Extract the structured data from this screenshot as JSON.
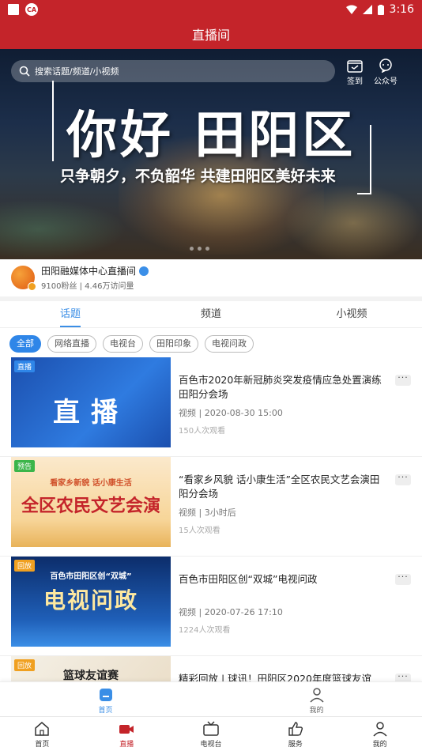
{
  "status_bar": {
    "time": "3:16",
    "app_badge": "CA"
  },
  "header": {
    "title": "直播间"
  },
  "banner": {
    "search_placeholder": "搜索话题/频道/小视频",
    "checkin_label": "签到",
    "official_label": "公众号",
    "headline": "你好 田阳区",
    "subline": "只争朝夕，不负韶华  共建田阳区美好未来"
  },
  "host": {
    "name": "田阳融媒体中心直播间",
    "stats": "9100粉丝 | 4.46万访问量"
  },
  "tabs": [
    {
      "label": "话题",
      "active": true
    },
    {
      "label": "频道"
    },
    {
      "label": "小视频"
    }
  ],
  "chips": [
    {
      "label": "全部",
      "active": true
    },
    {
      "label": "网络直播"
    },
    {
      "label": "电视台"
    },
    {
      "label": "田阳印象"
    },
    {
      "label": "电视问政"
    }
  ],
  "items": [
    {
      "tag": "直播",
      "tag_color": "#2f86e8",
      "thumb_text": "直播",
      "title": "百色市2020年新冠肺炎突发疫情应急处置演练田阳分会场",
      "meta": "视频 | 2020-08-30 15:00",
      "views": "150人次观看",
      "more": "···"
    },
    {
      "tag": "预告",
      "tag_color": "#3bb54a",
      "thumb_text": "全区农民文艺会演",
      "thumb_sub": "看家乡新貌  话小康生活",
      "title": "“看家乡风貌 话小康生活”全区农民文艺会演田阳分会场",
      "meta": "视频 | 3小时后",
      "views": "15人次观看",
      "more": "···"
    },
    {
      "tag": "回放",
      "tag_color": "#f0a020",
      "thumb_text": "电视问政",
      "thumb_sub": "百色市田阳区创“双城”",
      "title": "百色市田阳区创“双城”电视问政",
      "meta": "视频 | 2020-07-26 17:10",
      "views": "1224人次观看",
      "more": "···"
    },
    {
      "tag": "回放",
      "tag_color": "#f0a020",
      "thumb_text": "篮球友谊赛",
      "title": "精彩回放 | 球讯！田阳区2020年度篮球友谊",
      "more": "···"
    }
  ],
  "inner_nav": [
    {
      "label": "首页",
      "icon": "home-icon",
      "active": true
    },
    {
      "label": "我的",
      "icon": "person-icon"
    }
  ],
  "bottom_nav": [
    {
      "label": "首页",
      "icon": "home-icon"
    },
    {
      "label": "直播",
      "icon": "video-camera-icon",
      "active": true
    },
    {
      "label": "电视台",
      "icon": "tv-icon"
    },
    {
      "label": "服务",
      "icon": "thumbs-up-icon"
    },
    {
      "label": "我的",
      "icon": "person-icon"
    }
  ]
}
